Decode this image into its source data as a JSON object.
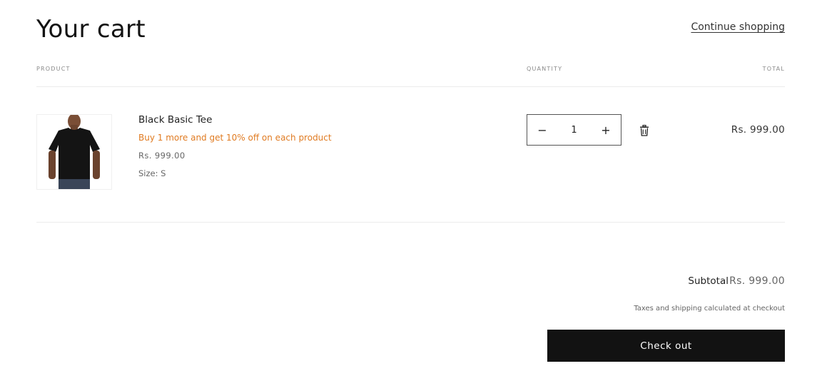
{
  "header": {
    "title": "Your cart",
    "continue_label": "Continue shopping"
  },
  "columns": {
    "product": "PRODUCT",
    "quantity": "QUANTITY",
    "total": "TOTAL"
  },
  "items": [
    {
      "name": "Black Basic Tee",
      "promo": "Buy 1 more and get 10% off on each product",
      "price": "Rs. 999.00",
      "variant": "Size: S",
      "quantity": "1",
      "line_total": "Rs. 999.00",
      "image": "black-tshirt-model"
    }
  ],
  "summary": {
    "subtotal_label": "Subtotal",
    "subtotal_value": "Rs. 999.00",
    "tax_note": "Taxes and shipping calculated at checkout",
    "checkout_label": "Check out"
  },
  "colors": {
    "promo": "#e07b22",
    "checkout_bg": "#121212"
  }
}
